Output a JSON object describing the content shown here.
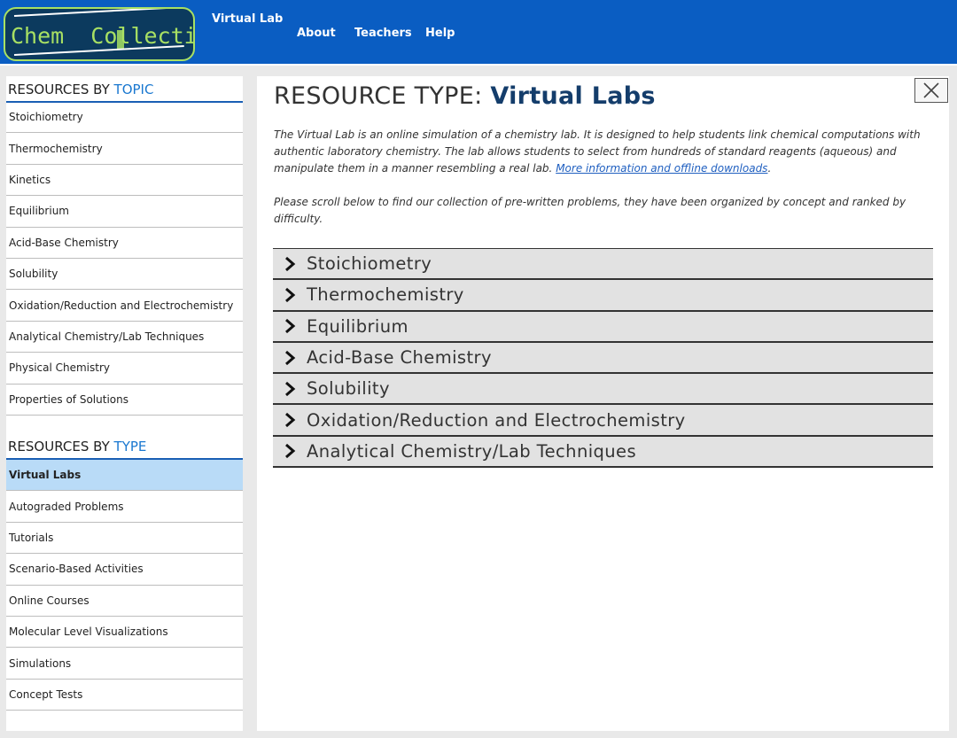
{
  "header": {
    "logo_text": "Chem  Collective",
    "brand": "Virtual Lab",
    "nav": [
      "About",
      "Teachers",
      "Help"
    ]
  },
  "sidebar": {
    "topic_heading_prefix": "RESOURCES BY ",
    "topic_heading_accent": "TOPIC",
    "topics": [
      "Stoichiometry",
      "Thermochemistry",
      "Kinetics",
      "Equilibrium",
      "Acid-Base Chemistry",
      "Solubility",
      "Oxidation/Reduction and Electrochemistry",
      "Analytical Chemistry/Lab Techniques",
      "Physical Chemistry",
      "Properties of Solutions"
    ],
    "type_heading_prefix": "RESOURCES BY ",
    "type_heading_accent": "TYPE",
    "types": [
      "Virtual Labs",
      "Autograded Problems",
      "Tutorials",
      "Scenario-Based Activities",
      "Online Courses",
      "Molecular Level Visualizations",
      "Simulations",
      "Concept Tests"
    ],
    "active_type": "Virtual Labs"
  },
  "main": {
    "title_prefix": "RESOURCE TYPE: ",
    "title_accent": "Virtual Labs",
    "desc1": "The Virtual Lab is an online simulation of a chemistry lab. It is designed to help students link chemical computations with authentic laboratory chemistry. The lab allows students to select from hundreds of standard reagents (aqueous) and manipulate them in a manner resembling a real lab. ",
    "desc1_link": "More information and offline downloads",
    "desc1_end": ".",
    "desc2": "Please scroll below to find our collection of pre-written problems, they have been organized by concept and ranked by difficulty.",
    "sections": [
      "Stoichiometry",
      "Thermochemistry",
      "Equilibrium",
      "Acid-Base Chemistry",
      "Solubility",
      "Oxidation/Reduction and Electrochemistry",
      "Analytical Chemistry/Lab Techniques"
    ]
  },
  "icons": {
    "close": "close-icon",
    "chevron": "chevron-right-icon"
  },
  "colors": {
    "header_bg": "#0a5dc2",
    "accent_blue": "#1a78d0",
    "active_bg": "#b9dbf7",
    "title_accent": "#143d6b"
  }
}
